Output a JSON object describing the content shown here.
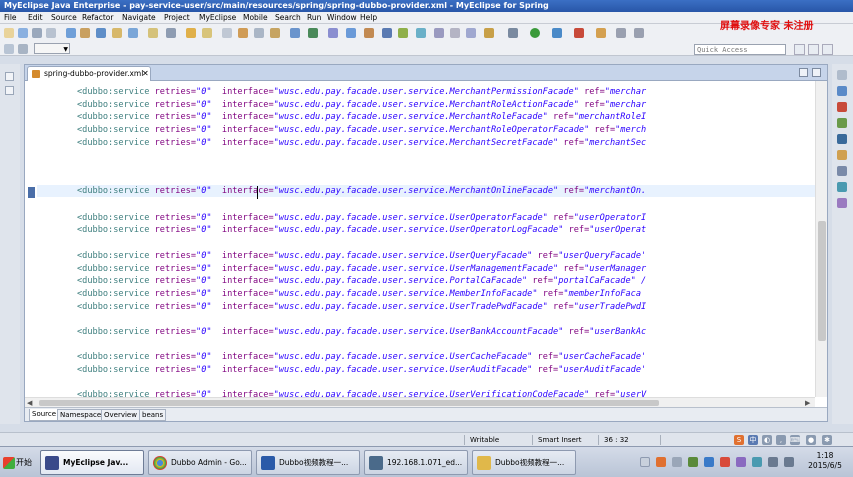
{
  "window": {
    "title": "MyEclipse Java Enterprise - pay-service-user/src/main/resources/spring/spring-dubbo-provider.xml - MyEclipse for Spring"
  },
  "watermark": "屏幕录像专家 未注册",
  "menu": [
    "File",
    "Edit",
    "Source",
    "Refactor",
    "Navigate",
    "Project",
    "MyEclipse",
    "Mobile",
    "Search",
    "Run",
    "Window",
    "Help"
  ],
  "toolbar": {
    "quick_access_placeholder": "Quick Access"
  },
  "editor": {
    "tab_label": "spring-dubbo-provider.xml",
    "tab_close": "✕",
    "lines": [
      {
        "tag": "<dubbo:service",
        "attr1": " retries=",
        "val1": "\"0\"",
        "attr2": "  interface=",
        "val2": "\"wusc.edu.pay.facade.user.service.MerchantPermissionFacade\"",
        "attr3": " ref=",
        "val3": "\"merchar"
      },
      {
        "tag": "<dubbo:service",
        "attr1": " retries=",
        "val1": "\"0\"",
        "attr2": "  interface=",
        "val2": "\"wusc.edu.pay.facade.user.service.MerchantRoleActionFacade\"",
        "attr3": " ref=",
        "val3": "\"merchar"
      },
      {
        "tag": "<dubbo:service",
        "attr1": " retries=",
        "val1": "\"0\"",
        "attr2": "  interface=",
        "val2": "\"wusc.edu.pay.facade.user.service.MerchantRoleFacade\"",
        "attr3": " ref=",
        "val3": "\"merchantRoleI"
      },
      {
        "tag": "<dubbo:service",
        "attr1": " retries=",
        "val1": "\"0\"",
        "attr2": "  interface=",
        "val2": "\"wusc.edu.pay.facade.user.service.MerchantRoleOperatorFacade\"",
        "attr3": " ref=",
        "val3": "\"merch"
      },
      {
        "tag": "<dubbo:service",
        "attr1": " retries=",
        "val1": "\"0\"",
        "attr2": "  interface=",
        "val2": "\"wusc.edu.pay.facade.user.service.MerchantSecretFacade\"",
        "attr3": " ref=",
        "val3": "\"merchantSec"
      },
      {
        "tag": "<dubbo:service",
        "attr1": " retries=",
        "val1": "\"0\"",
        "attr2": "  interface=",
        "val2": "\"wusc.edu.pay.facade.user.service.MerchantOnlineFacade\"",
        "attr3": " ref=",
        "val3": "\"merchantOn."
      },
      {
        "tag": "<dubbo:service",
        "attr1": " retries=",
        "val1": "\"0\"",
        "attr2": "  interface=",
        "val2": "\"wusc.edu.pay.facade.user.service.UserOperatorFacade\"",
        "attr3": " ref=",
        "val3": "\"userOperatorI"
      },
      {
        "tag": "<dubbo:service",
        "attr1": " retries=",
        "val1": "\"0\"",
        "attr2": "  interface=",
        "val2": "\"wusc.edu.pay.facade.user.service.UserOperatorLogFacade\"",
        "attr3": " ref=",
        "val3": "\"userOperat"
      },
      {
        "tag": "<dubbo:service",
        "attr1": " retries=",
        "val1": "\"0\"",
        "attr2": "  interface=",
        "val2": "\"wusc.edu.pay.facade.user.service.UserQueryFacade\"",
        "attr3": " ref=",
        "val3": "\"userQueryFacade'"
      },
      {
        "tag": "<dubbo:service",
        "attr1": " retries=",
        "val1": "\"0\"",
        "attr2": "  interface=",
        "val2": "\"wusc.edu.pay.facade.user.service.UserManagementFacade\"",
        "attr3": " ref=",
        "val3": "\"userManager"
      },
      {
        "tag": "<dubbo:service",
        "attr1": " retries=",
        "val1": "\"0\"",
        "attr2": "  interface=",
        "val2": "\"wusc.edu.pay.facade.user.service.PortalCaFacade\"",
        "attr3": " ref=",
        "val3": "\"portalCaFacade\" /"
      },
      {
        "tag": "<dubbo:service",
        "attr1": " retries=",
        "val1": "\"0\"",
        "attr2": "  interface=",
        "val2": "\"wusc.edu.pay.facade.user.service.MemberInfoFacade\"",
        "attr3": " ref=",
        "val3": "\"memberInfoFaca"
      },
      {
        "tag": "<dubbo:service",
        "attr1": " retries=",
        "val1": "\"0\"",
        "attr2": "  interface=",
        "val2": "\"wusc.edu.pay.facade.user.service.UserTradePwdFacade\"",
        "attr3": " ref=",
        "val3": "\"userTradePwdI"
      },
      {
        "tag": "<dubbo:service",
        "attr1": " retries=",
        "val1": "\"0\"",
        "attr2": "  interface=",
        "val2": "\"wusc.edu.pay.facade.user.service.UserBankAccountFacade\"",
        "attr3": " ref=",
        "val3": "\"userBankAc"
      },
      {
        "tag": "<dubbo:service",
        "attr1": " retries=",
        "val1": "\"0\"",
        "attr2": "  interface=",
        "val2": "\"wusc.edu.pay.facade.user.service.UserCacheFacade\"",
        "attr3": " ref=",
        "val3": "\"userCacheFacade'"
      },
      {
        "tag": "<dubbo:service",
        "attr1": " retries=",
        "val1": "\"0\"",
        "attr2": "  interface=",
        "val2": "\"wusc.edu.pay.facade.user.service.UserAuditFacade\"",
        "attr3": " ref=",
        "val3": "\"userAuditFacade'"
      },
      {
        "tag": "<dubbo:service",
        "attr1": " retries=",
        "val1": "\"0\"",
        "attr2": "  interface=",
        "val2": "\"wusc.edu.pay.facade.user.service.UserVerificationCodeFacade\"",
        "attr3": " ref=",
        "val3": "\"userV"
      }
    ],
    "bottom_tabs": [
      "Source",
      "Namespaces",
      "Overview",
      "beans"
    ]
  },
  "status": {
    "writable": "Writable",
    "insert_mode": "Smart Insert",
    "position": "36 : 32"
  },
  "taskbar": {
    "start_label": "开始",
    "tasks": [
      {
        "label": "MyEclipse Jav...",
        "icon": "myeclipse-icon",
        "active": true
      },
      {
        "label": "Dubbo Admin - Go...",
        "icon": "chrome-icon",
        "active": false
      },
      {
        "label": "Dubbo视频教程一...",
        "icon": "word-icon",
        "active": false
      },
      {
        "label": "192.168.1.071_ed...",
        "icon": "remote-desktop-icon",
        "active": false
      },
      {
        "label": "Dubbo视频教程一...",
        "icon": "folder-icon",
        "active": false
      }
    ],
    "clock_time": "1:18",
    "clock_date": "2015/6/5"
  },
  "colors": {
    "xml_tag": "#3f7f7f",
    "xml_attr": "#7f007f",
    "xml_value": "#2a00ff",
    "title_bar": "#2856a8",
    "watermark": "#e01010"
  }
}
